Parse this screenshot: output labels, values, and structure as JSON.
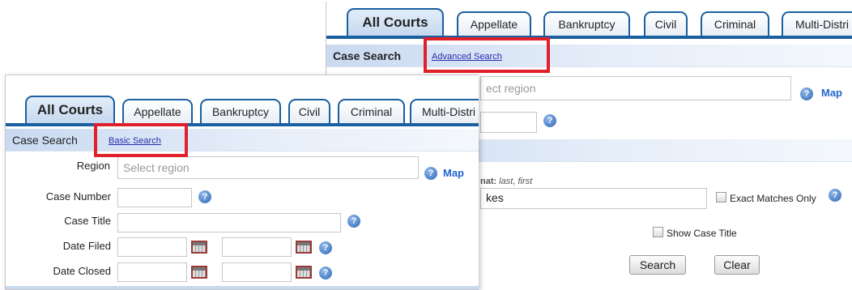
{
  "back": {
    "tabs": [
      "All Courts",
      "Appellate",
      "Bankruptcy",
      "Civil",
      "Criminal",
      "Multi-Distri"
    ],
    "case_search": "Case Search",
    "advanced_search_link": "Advanced Search",
    "region_placeholder": "ect region",
    "map_label": "Map",
    "name_hint_label": "nat:",
    "name_hint_value": "last, first",
    "name_value": "kes",
    "exact_matches_label": "Exact Matches Only",
    "show_case_title_label": "Show Case Title",
    "search_button": "Search",
    "clear_button": "Clear"
  },
  "front": {
    "tabs": [
      "All Courts",
      "Appellate",
      "Bankruptcy",
      "Civil",
      "Criminal",
      "Multi-Distri"
    ],
    "case_search": "Case Search",
    "basic_search_link": "Basic Search",
    "region_label": "Region",
    "region_placeholder": "Select region",
    "map_label": "Map",
    "case_number_label": "Case Number",
    "case_title_label": "Case Title",
    "date_filed_label": "Date Filed",
    "date_closed_label": "Date Closed"
  },
  "icons": {
    "help": "help-circle-icon",
    "calendar": "calendar-icon"
  },
  "colors": {
    "tab_border": "#1a5fa0",
    "highlight": "#e0202a",
    "link": "#2a2ab0",
    "map_link": "#2266cc"
  }
}
